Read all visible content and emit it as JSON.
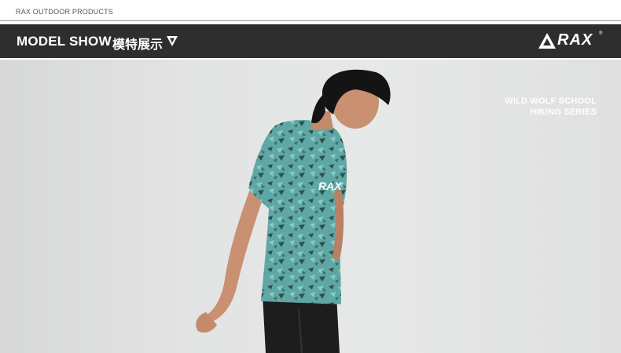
{
  "header": {
    "caption": "RAX OUTDOOR PRODUCTS",
    "title": "MODEL SHOW",
    "title_cn": "模特展示",
    "logo_text": "RAX",
    "logo_reg": "®"
  },
  "photo": {
    "tag_line1": "WILD WOLF SCHOOL",
    "tag_line2": "HIKING SERIES",
    "shirt_logo": "RAX"
  },
  "colors": {
    "bar": "#2e2e2e",
    "shirt": "#5fa7a5",
    "background": "#e2e3e3"
  }
}
